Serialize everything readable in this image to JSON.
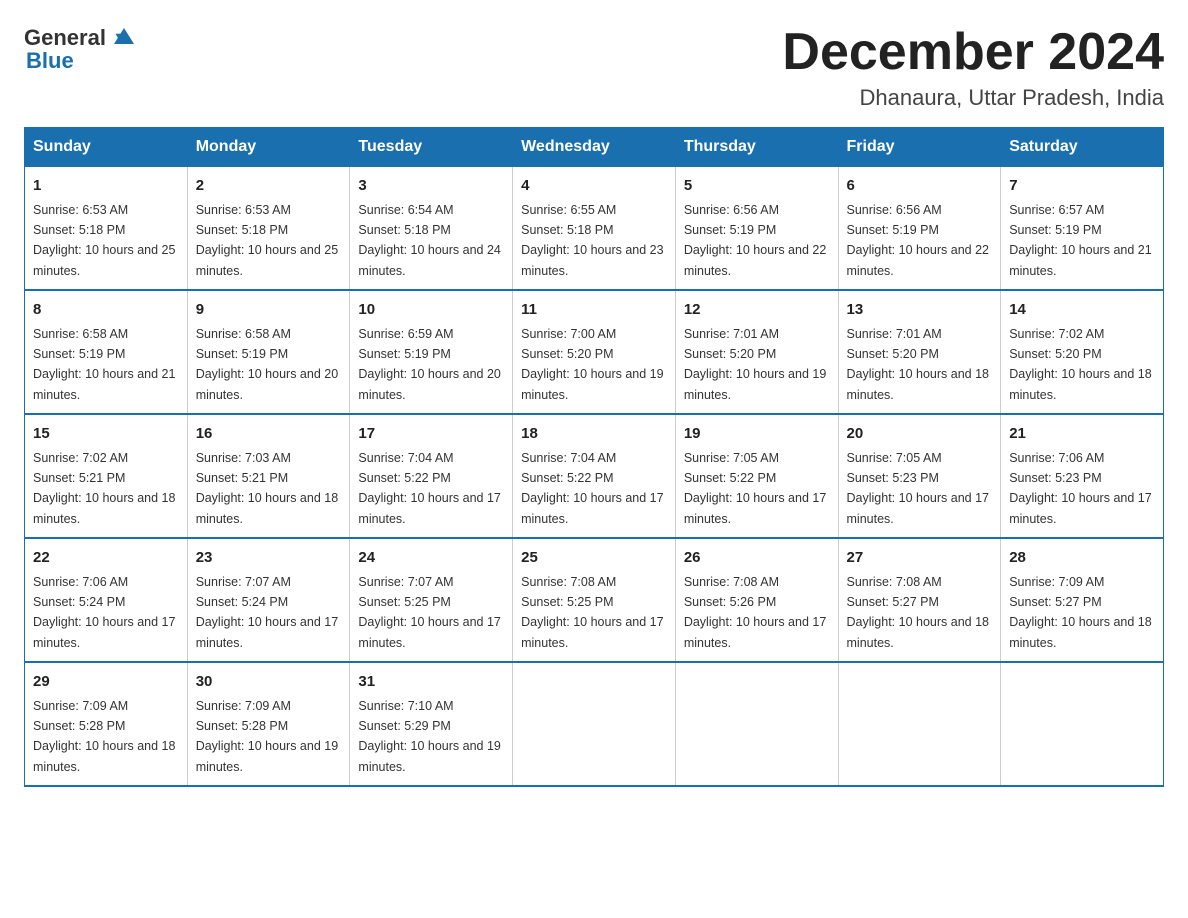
{
  "logo": {
    "text_general": "General",
    "text_blue": "Blue"
  },
  "title": "December 2024",
  "location": "Dhanaura, Uttar Pradesh, India",
  "days_of_week": [
    "Sunday",
    "Monday",
    "Tuesday",
    "Wednesday",
    "Thursday",
    "Friday",
    "Saturday"
  ],
  "weeks": [
    [
      {
        "day": "1",
        "sunrise": "6:53 AM",
        "sunset": "5:18 PM",
        "daylight": "10 hours and 25 minutes."
      },
      {
        "day": "2",
        "sunrise": "6:53 AM",
        "sunset": "5:18 PM",
        "daylight": "10 hours and 25 minutes."
      },
      {
        "day": "3",
        "sunrise": "6:54 AM",
        "sunset": "5:18 PM",
        "daylight": "10 hours and 24 minutes."
      },
      {
        "day": "4",
        "sunrise": "6:55 AM",
        "sunset": "5:18 PM",
        "daylight": "10 hours and 23 minutes."
      },
      {
        "day": "5",
        "sunrise": "6:56 AM",
        "sunset": "5:19 PM",
        "daylight": "10 hours and 22 minutes."
      },
      {
        "day": "6",
        "sunrise": "6:56 AM",
        "sunset": "5:19 PM",
        "daylight": "10 hours and 22 minutes."
      },
      {
        "day": "7",
        "sunrise": "6:57 AM",
        "sunset": "5:19 PM",
        "daylight": "10 hours and 21 minutes."
      }
    ],
    [
      {
        "day": "8",
        "sunrise": "6:58 AM",
        "sunset": "5:19 PM",
        "daylight": "10 hours and 21 minutes."
      },
      {
        "day": "9",
        "sunrise": "6:58 AM",
        "sunset": "5:19 PM",
        "daylight": "10 hours and 20 minutes."
      },
      {
        "day": "10",
        "sunrise": "6:59 AM",
        "sunset": "5:19 PM",
        "daylight": "10 hours and 20 minutes."
      },
      {
        "day": "11",
        "sunrise": "7:00 AM",
        "sunset": "5:20 PM",
        "daylight": "10 hours and 19 minutes."
      },
      {
        "day": "12",
        "sunrise": "7:01 AM",
        "sunset": "5:20 PM",
        "daylight": "10 hours and 19 minutes."
      },
      {
        "day": "13",
        "sunrise": "7:01 AM",
        "sunset": "5:20 PM",
        "daylight": "10 hours and 18 minutes."
      },
      {
        "day": "14",
        "sunrise": "7:02 AM",
        "sunset": "5:20 PM",
        "daylight": "10 hours and 18 minutes."
      }
    ],
    [
      {
        "day": "15",
        "sunrise": "7:02 AM",
        "sunset": "5:21 PM",
        "daylight": "10 hours and 18 minutes."
      },
      {
        "day": "16",
        "sunrise": "7:03 AM",
        "sunset": "5:21 PM",
        "daylight": "10 hours and 18 minutes."
      },
      {
        "day": "17",
        "sunrise": "7:04 AM",
        "sunset": "5:22 PM",
        "daylight": "10 hours and 17 minutes."
      },
      {
        "day": "18",
        "sunrise": "7:04 AM",
        "sunset": "5:22 PM",
        "daylight": "10 hours and 17 minutes."
      },
      {
        "day": "19",
        "sunrise": "7:05 AM",
        "sunset": "5:22 PM",
        "daylight": "10 hours and 17 minutes."
      },
      {
        "day": "20",
        "sunrise": "7:05 AM",
        "sunset": "5:23 PM",
        "daylight": "10 hours and 17 minutes."
      },
      {
        "day": "21",
        "sunrise": "7:06 AM",
        "sunset": "5:23 PM",
        "daylight": "10 hours and 17 minutes."
      }
    ],
    [
      {
        "day": "22",
        "sunrise": "7:06 AM",
        "sunset": "5:24 PM",
        "daylight": "10 hours and 17 minutes."
      },
      {
        "day": "23",
        "sunrise": "7:07 AM",
        "sunset": "5:24 PM",
        "daylight": "10 hours and 17 minutes."
      },
      {
        "day": "24",
        "sunrise": "7:07 AM",
        "sunset": "5:25 PM",
        "daylight": "10 hours and 17 minutes."
      },
      {
        "day": "25",
        "sunrise": "7:08 AM",
        "sunset": "5:25 PM",
        "daylight": "10 hours and 17 minutes."
      },
      {
        "day": "26",
        "sunrise": "7:08 AM",
        "sunset": "5:26 PM",
        "daylight": "10 hours and 17 minutes."
      },
      {
        "day": "27",
        "sunrise": "7:08 AM",
        "sunset": "5:27 PM",
        "daylight": "10 hours and 18 minutes."
      },
      {
        "day": "28",
        "sunrise": "7:09 AM",
        "sunset": "5:27 PM",
        "daylight": "10 hours and 18 minutes."
      }
    ],
    [
      {
        "day": "29",
        "sunrise": "7:09 AM",
        "sunset": "5:28 PM",
        "daylight": "10 hours and 18 minutes."
      },
      {
        "day": "30",
        "sunrise": "7:09 AM",
        "sunset": "5:28 PM",
        "daylight": "10 hours and 19 minutes."
      },
      {
        "day": "31",
        "sunrise": "7:10 AM",
        "sunset": "5:29 PM",
        "daylight": "10 hours and 19 minutes."
      },
      null,
      null,
      null,
      null
    ]
  ]
}
